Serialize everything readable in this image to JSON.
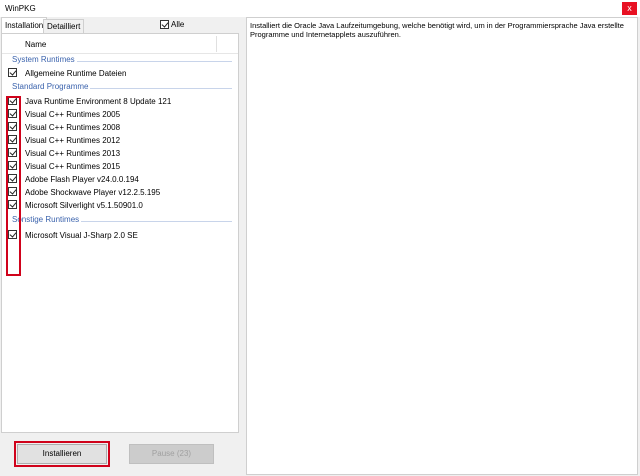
{
  "window": {
    "title": "WinPKG",
    "close_glyph": "x"
  },
  "tabs": [
    {
      "label": "Installation",
      "active": true
    },
    {
      "label": "Detailliert",
      "active": false
    }
  ],
  "select_all": {
    "label": "Alle",
    "checked": true
  },
  "list": {
    "column_name": "Name",
    "groups": [
      {
        "label": "System Runtimes",
        "items": [
          {
            "label": "Allgemeine Runtime Dateien",
            "checked": true
          }
        ]
      },
      {
        "label": "Standard Programme",
        "items": [
          {
            "label": "Java Runtime Environment 8 Update 121",
            "checked": true
          },
          {
            "label": "Visual C++ Runtimes 2005",
            "checked": true
          },
          {
            "label": "Visual C++ Runtimes 2008",
            "checked": true
          },
          {
            "label": "Visual C++ Runtimes 2012",
            "checked": true
          },
          {
            "label": "Visual C++ Runtimes 2013",
            "checked": true
          },
          {
            "label": "Visual C++ Runtimes 2015",
            "checked": true
          },
          {
            "label": "Adobe Flash Player v24.0.0.194",
            "checked": true
          },
          {
            "label": "Adobe Shockwave Player v12.2.5.195",
            "checked": true
          },
          {
            "label": "Microsoft Silverlight v5.1.50901.0",
            "checked": true
          }
        ]
      },
      {
        "label": "Sonstige Runtimes",
        "items": [
          {
            "label": "Microsoft Visual J-Sharp 2.0 SE",
            "checked": true
          }
        ]
      }
    ]
  },
  "buttons": {
    "install_label": "Installieren",
    "pause_label": "Pause (23)"
  },
  "description": "Installiert die Oracle Java Laufzeitumgebung, welche benötigt wird, um in der Programmiersprache Java erstellte Programme und Internetapplets auszuführen.",
  "colors": {
    "highlight": "#d0021b",
    "group": "#3b63ad",
    "close": "#e81123"
  }
}
